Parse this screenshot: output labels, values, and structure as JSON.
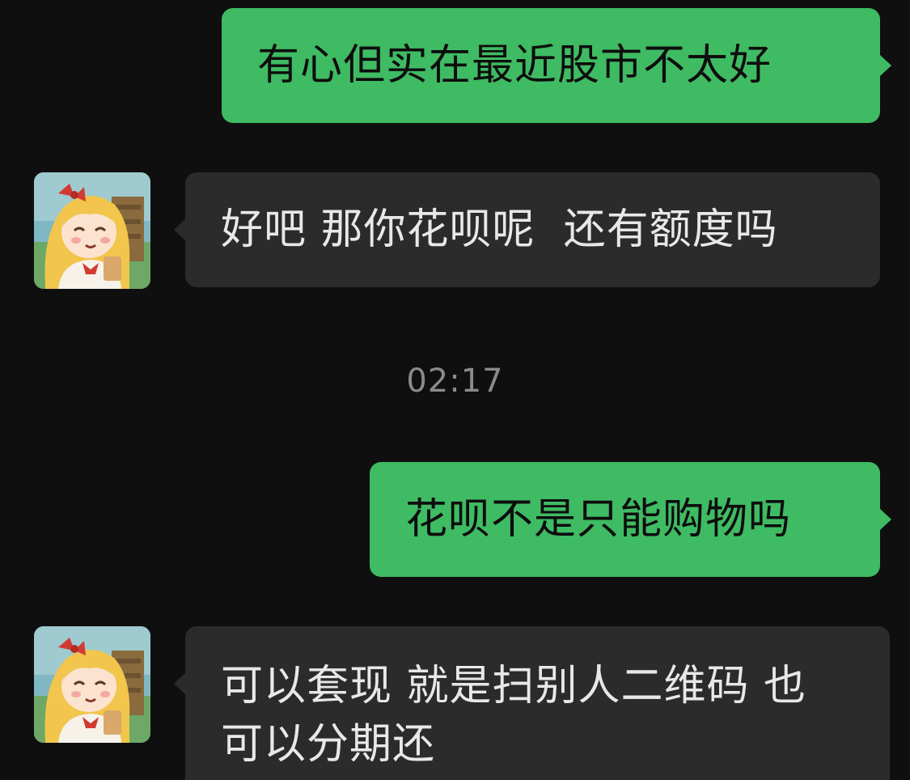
{
  "messages": [
    {
      "side": "me",
      "text": "有心但实在最近股市不太好"
    },
    {
      "side": "them",
      "text": "好吧 那你花呗呢  还有额度吗"
    },
    {
      "side": "me",
      "text": "花呗不是只能购物吗"
    },
    {
      "side": "them",
      "line1": "可以套现 就是扫别人二维码 也",
      "line2": "可以分期还"
    }
  ],
  "timestamp": "02:17",
  "colors": {
    "background": "#0f0f0f",
    "sent_bubble": "#3fbb63",
    "received_bubble": "#2b2b2b",
    "timestamp_text": "#8a8a8a"
  },
  "avatar_icon": "cartoon-girl-avatar"
}
